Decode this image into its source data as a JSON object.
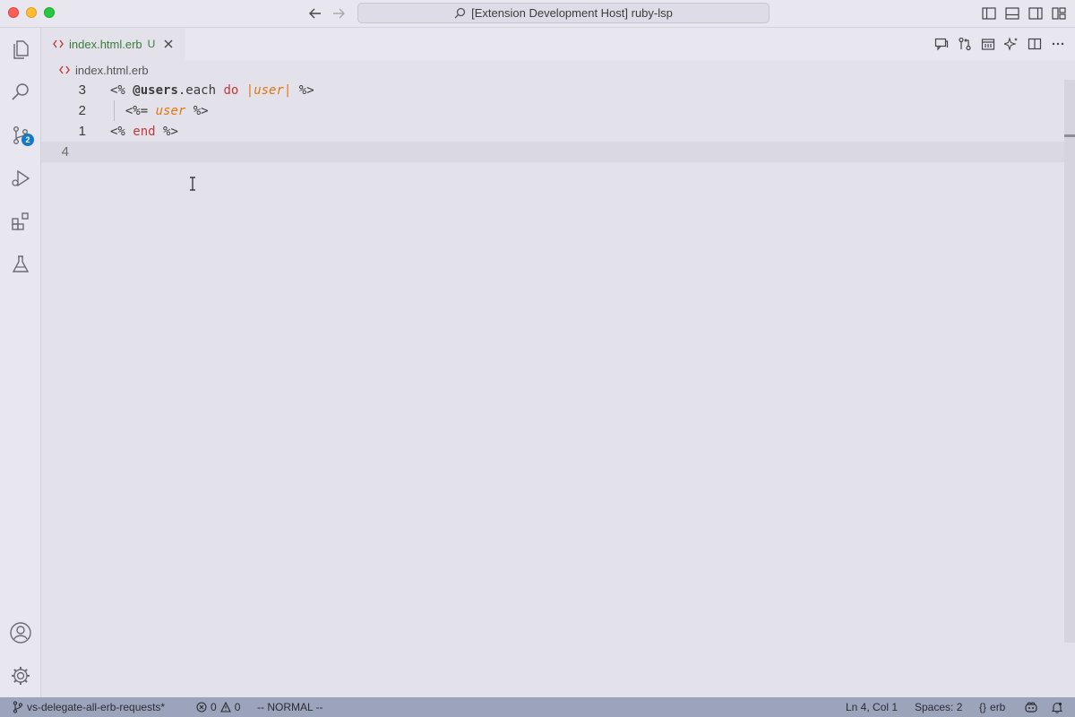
{
  "window": {
    "title": "[Extension Development Host] ruby-lsp"
  },
  "activity_bar": {
    "source_control_badge": "2"
  },
  "tabs": [
    {
      "filename": "index.html.erb",
      "status": "U"
    }
  ],
  "breadcrumb": {
    "file": "index.html.erb"
  },
  "editor": {
    "lines": [
      {
        "number": "3"
      },
      {
        "number": "2"
      },
      {
        "number": "1"
      },
      {
        "number": "4"
      }
    ],
    "tokens": {
      "open_tag": "<%",
      "ivar": "@users",
      "method": ".each",
      "do_kw": "do",
      "pipe_open": "|",
      "param": "user",
      "pipe_close": "|",
      "close_tag": "%>",
      "output_open": "<%=",
      "output_var": "user",
      "end_kw": "end"
    }
  },
  "status_bar": {
    "branch": "vs-delegate-all-erb-requests*",
    "errors": "0",
    "warnings": "0",
    "vim_mode": "-- NORMAL --",
    "cursor_position": "Ln 4, Col 1",
    "indentation": "Spaces: 2",
    "language": "erb"
  },
  "colors": {
    "status_bar_bg": "#9ca4bb",
    "keyword": "#c3383a",
    "parameter": "#e0770f",
    "badge": "#1578c8",
    "untracked_file": "#3a7d3a"
  }
}
